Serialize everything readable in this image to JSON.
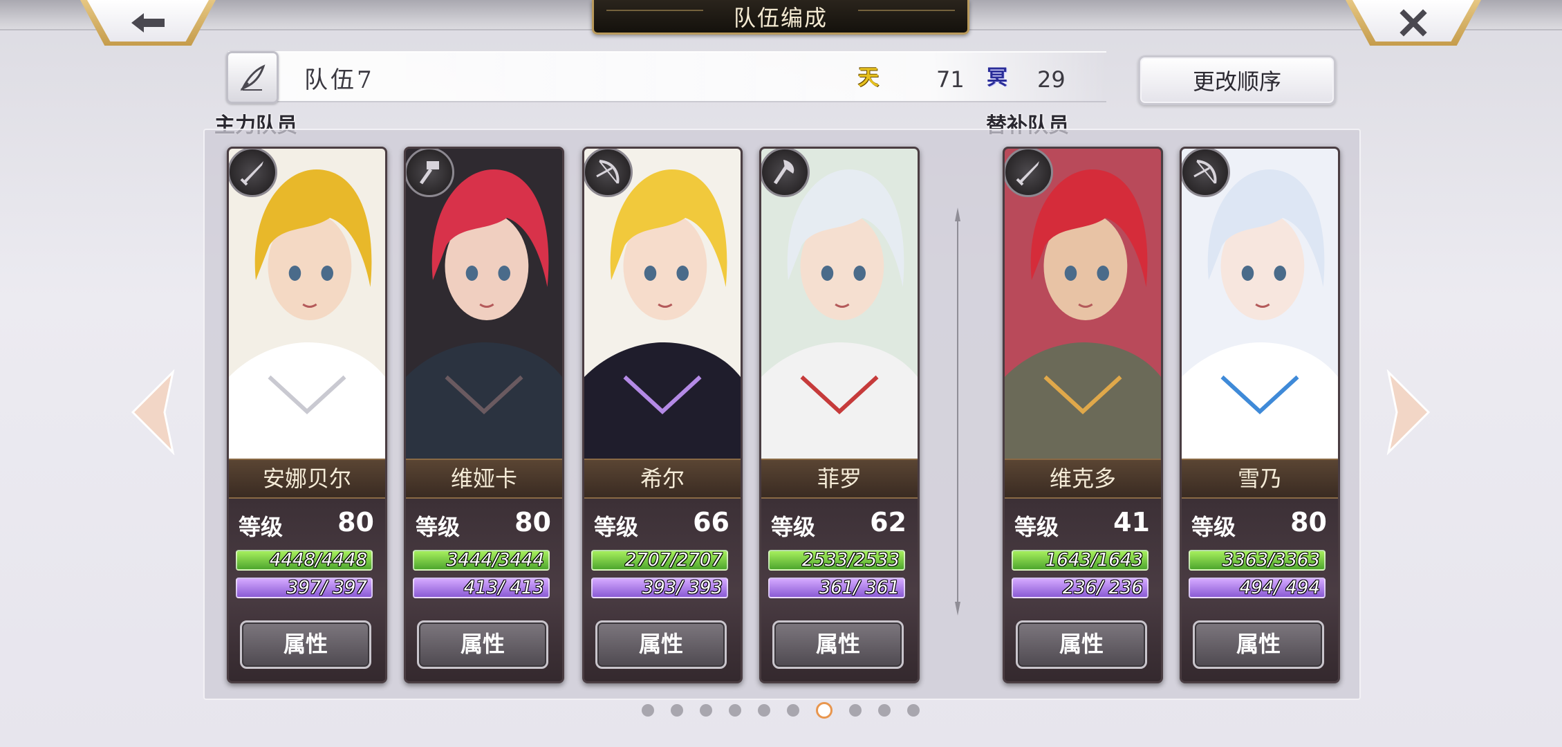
{
  "header": {
    "title": "队伍编成",
    "back_icon": "arrow-left-icon",
    "close_icon": "close-icon"
  },
  "team": {
    "name": "队伍7",
    "heaven_icon_text": "天",
    "heaven_value": "71",
    "hell_icon_text": "冥",
    "hell_value": "29",
    "reorder_label": "更改顺序"
  },
  "sections": {
    "main_label": "主力队员",
    "sub_label": "替补队员"
  },
  "labels": {
    "level": "等级",
    "attributes": "属性"
  },
  "colors": {
    "hp": "#6fcc3f",
    "mp": "#a97ee8",
    "active_dot": "#e8964e",
    "heaven": "#e6c01e",
    "hell": "#2a2d98"
  },
  "members": [
    {
      "name": "安娜贝尔",
      "level": "80",
      "hp": "4448/4448",
      "mp": "397/ 397",
      "class_icon": "sword-icon",
      "group": "main"
    },
    {
      "name": "维娅卡",
      "level": "80",
      "hp": "3444/3444",
      "mp": "413/ 413",
      "class_icon": "hammer-icon",
      "group": "main"
    },
    {
      "name": "希尔",
      "level": "66",
      "hp": "2707/2707",
      "mp": "393/ 393",
      "class_icon": "bow-icon",
      "group": "main"
    },
    {
      "name": "菲罗",
      "level": "62",
      "hp": "2533/2533",
      "mp": "361/ 361",
      "class_icon": "axe-icon",
      "group": "main"
    },
    {
      "name": "维克多",
      "level": "41",
      "hp": "1643/1643",
      "mp": "236/ 236",
      "class_icon": "sword-icon",
      "group": "sub"
    },
    {
      "name": "雪乃",
      "level": "80",
      "hp": "3363/3363",
      "mp": "494/ 494",
      "class_icon": "bow-icon",
      "group": "sub"
    }
  ],
  "pagination": {
    "total": 10,
    "active_index": 6
  }
}
